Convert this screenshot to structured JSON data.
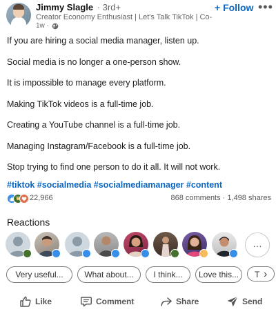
{
  "author": {
    "name": "Jimmy Slagle",
    "degree": "· 3rd+",
    "headline": "Creator Economy Enthusiast | Let's Talk TikTok | Co-Fou...",
    "time": "1w ·",
    "follow_label": "+ Follow",
    "more_label": "•••"
  },
  "post": {
    "lines": [
      "If you are hiring a social media manager, listen up.",
      "Social media is no longer a one-person show.",
      "It is impossible to manage every platform.",
      "Making TikTok videos is a full-time job.",
      "Creating a YouTube channel is a full-time job.",
      "Managing Instagram/Facebook is a full-time job.",
      "Stop trying to find one person to do it all. It will not work."
    ],
    "hashtags": [
      "#tiktok",
      "#socialmedia",
      "#socialmediamanager",
      "#content"
    ]
  },
  "stats": {
    "reactions_count": "22,966",
    "comments_shares": "868 comments · 1,498 shares"
  },
  "reactions": {
    "title": "Reactions",
    "more_label": "…"
  },
  "suggestions": [
    "Very useful...",
    "What about...",
    "I think...",
    "Love this...",
    "T"
  ],
  "actions": {
    "like": "Like",
    "comment": "Comment",
    "repost": "Share",
    "send": "Send"
  },
  "colors": {
    "link_blue": "#0a66c2",
    "like_blue": "#378fe9",
    "celebrate_green": "#44712e",
    "love_red": "#df704d"
  }
}
